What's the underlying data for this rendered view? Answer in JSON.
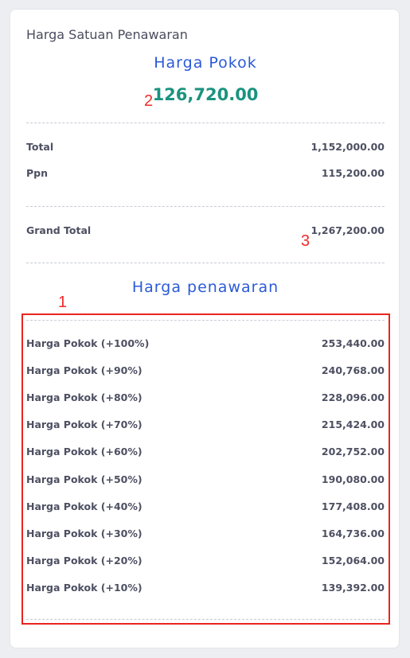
{
  "card": {
    "title": "Harga Satuan Penawaran",
    "harga_pokok_label": "Harga Pokok",
    "harga_pokok_value": "126,720.00",
    "summary": [
      {
        "label": "Total",
        "value": "1,152,000.00"
      },
      {
        "label": "Ppn",
        "value": "115,200.00"
      }
    ],
    "grand_total": {
      "label": "Grand Total",
      "value": "1,267,200.00"
    },
    "harga_penawaran_label": "Harga penawaran",
    "offers": [
      {
        "label": "Harga Pokok (+100%)",
        "value": "253,440.00"
      },
      {
        "label": "Harga Pokok (+90%)",
        "value": "240,768.00"
      },
      {
        "label": "Harga Pokok (+80%)",
        "value": "228,096.00"
      },
      {
        "label": "Harga Pokok (+70%)",
        "value": "215,424.00"
      },
      {
        "label": "Harga Pokok (+60%)",
        "value": "202,752.00"
      },
      {
        "label": "Harga Pokok (+50%)",
        "value": "190,080.00"
      },
      {
        "label": "Harga Pokok (+40%)",
        "value": "177,408.00"
      },
      {
        "label": "Harga Pokok (+30%)",
        "value": "164,736.00"
      },
      {
        "label": "Harga Pokok (+20%)",
        "value": "152,064.00"
      },
      {
        "label": "Harga Pokok (+10%)",
        "value": "139,392.00"
      }
    ]
  },
  "annotations": {
    "one": "1",
    "two": "2",
    "three": "3"
  }
}
